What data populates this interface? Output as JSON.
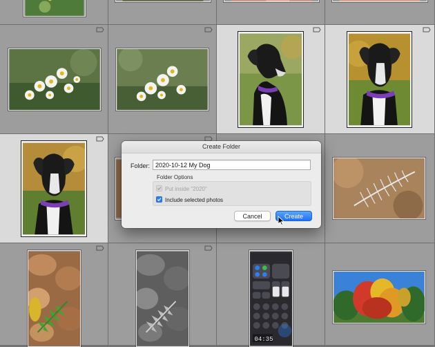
{
  "dialog": {
    "title": "Create Folder",
    "folder_label": "Folder:",
    "folder_value": "2020-10-12 My Dog",
    "options_title": "Folder Options",
    "option_put_inside": "Put inside \"2020\"",
    "option_put_inside_checked": true,
    "option_put_inside_enabled": false,
    "option_include_selected": "Include selected photos",
    "option_include_selected_checked": true,
    "cancel_label": "Cancel",
    "create_label": "Create"
  },
  "grid": {
    "phone_time": "04:35",
    "selected_cells": [
      "dog-1",
      "dog-2",
      "dog-3"
    ]
  },
  "colors": {
    "accent": "#1d73f0",
    "grid_background": "#9d9d9d",
    "selected_cell": "#dadada"
  }
}
